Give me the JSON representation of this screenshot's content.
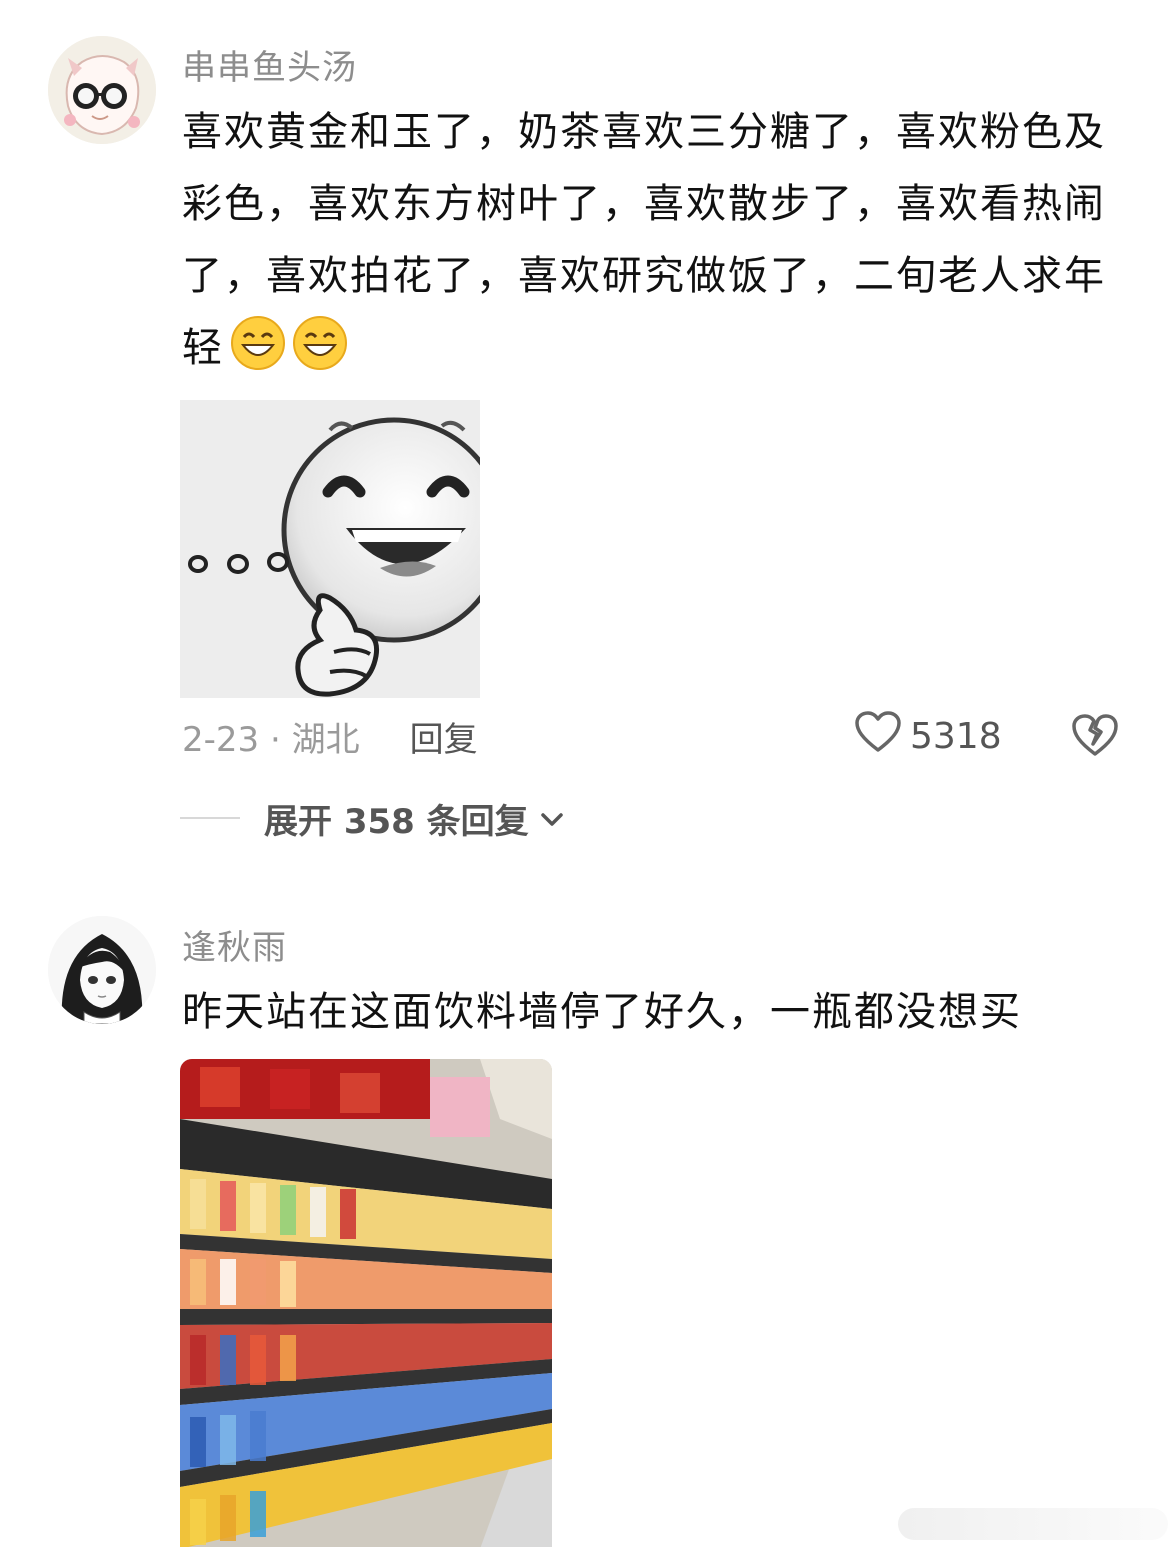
{
  "comments": [
    {
      "username": "串串鱼头汤",
      "text": "喜欢黄金和玉了，奶茶喜欢三分糖了，喜欢粉色及彩色，喜欢东方树叶了，喜欢散步了，喜欢看热闹了，喜欢拍花了，喜欢研究做饭了，二旬老人求年轻",
      "emojis": [
        "grin-emoji",
        "grin-emoji"
      ],
      "sticker": "thinking-smile-sticker",
      "date_location": "2-23 · 湖北",
      "reply_label": "回复",
      "likes": "5318",
      "expand_label": "展开 358 条回复"
    },
    {
      "username": "逢秋雨",
      "text": "昨天站在这面饮料墙停了好久，一瓶都没想买",
      "photo": "drink-shelf-photo"
    }
  ],
  "colors": {
    "username": "#8d8d8d",
    "meta": "#9a9a9a",
    "text": "#111111"
  }
}
